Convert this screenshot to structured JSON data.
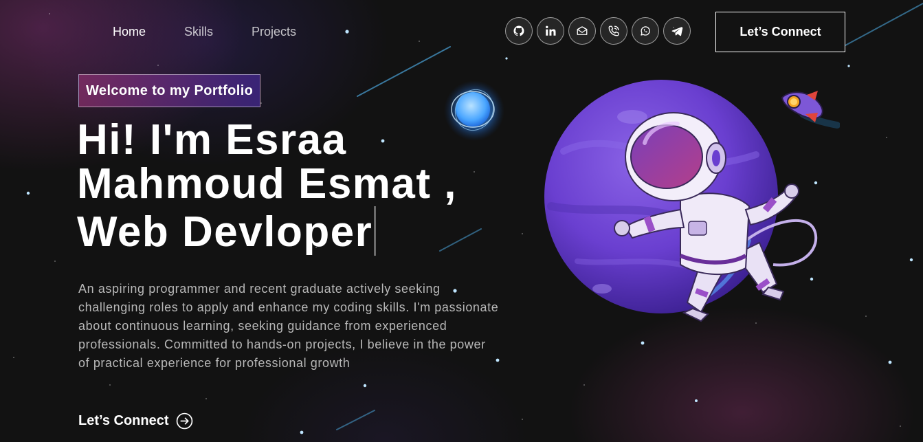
{
  "nav": {
    "links": [
      {
        "label": "Home",
        "active": true
      },
      {
        "label": "Skills",
        "active": false
      },
      {
        "label": "Projects",
        "active": false
      }
    ],
    "social_icons": [
      "github-icon",
      "linkedin-icon",
      "email-icon",
      "phone-icon",
      "whatsapp-icon",
      "telegram-icon"
    ],
    "connect_label": "Let’s Connect"
  },
  "hero": {
    "tagline": "Welcome to my Portfolio",
    "headline_line1": "Hi! I'm Esraa",
    "headline_line2": "Mahmoud Esmat ,",
    "headline_line3": "Web Devloper",
    "bio": "An aspiring programmer and recent graduate actively seeking challenging roles to apply and enhance my coding skills. I'm passionate about continuous learning, seeking guidance from experienced professionals. Committed to hands-on projects, I believe in the power of practical experience for professional growth",
    "cta_label": "Let’s Connect"
  },
  "colors": {
    "background": "#121212",
    "text": "#ffffff",
    "muted_text": "#B8B8B8",
    "tagline_gradient_start": "#AA367C",
    "tagline_gradient_end": "#4A2FBD",
    "planet": "#6A3FD0"
  }
}
